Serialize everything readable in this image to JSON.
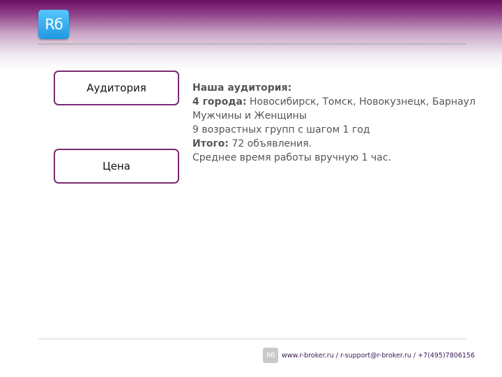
{
  "logo": {
    "text": "Rб"
  },
  "boxes": {
    "audience": "Аудитория",
    "price": "Цена"
  },
  "content": {
    "heading": "Наша аудитория:",
    "cities_label": "4 города:",
    "cities_value": " Новосибирск, Томск, Новокузнецк, Барнаул",
    "gender": "Мужчины и Женщины",
    "age_groups": "9 возрастных групп с шагом 1 год",
    "total_label": "Итого:",
    "total_value": " 72 объявления.",
    "time": "Среднее время работы вручную 1 час."
  },
  "footer": {
    "logo_text": "Rб",
    "contacts": "www.r-broker.ru / r-support@r-broker.ru / +7(495)7806156"
  }
}
